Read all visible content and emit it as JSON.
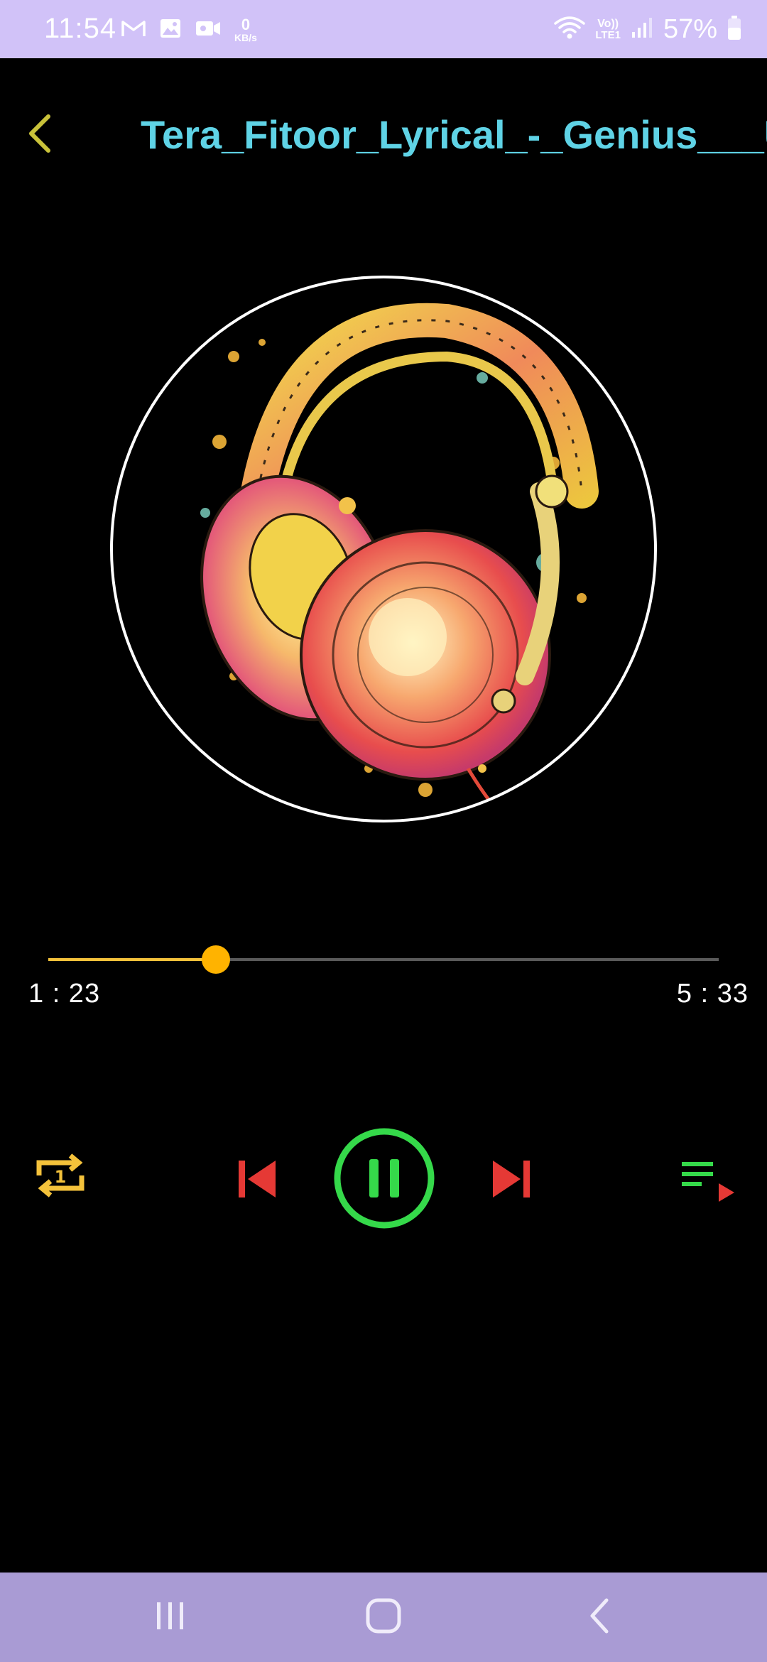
{
  "status_bar": {
    "time": "11:54",
    "network_speed_value": "0",
    "network_speed_unit": "KB/s",
    "volte_top": "Vo))",
    "volte_bottom": "LTE1",
    "battery": "57%",
    "icons_left": [
      "gmail-icon",
      "gallery-icon",
      "video-call-icon"
    ],
    "icons_right": [
      "wifi-icon",
      "signal-icon",
      "battery-icon"
    ]
  },
  "header": {
    "title": "Tera_Fitoor_Lyrical_-_Genius___Utkarsh_Sharma",
    "back_icon": "chevron-left-icon"
  },
  "player": {
    "elapsed": "1 : 23",
    "duration": "5 : 33",
    "progress": 0.25
  },
  "controls": {
    "repeat_icon": "repeat-one-icon",
    "previous_icon": "skip-previous-icon",
    "play_pause_icon": "pause-icon",
    "next_icon": "skip-next-icon",
    "queue_icon": "queue-music-icon"
  },
  "colors": {
    "accent_title": "#5fd3e6",
    "back_arrow": "#c9c23a",
    "seek_fill": "#f4c23b",
    "seek_thumb": "#ffb300",
    "repeat": "#f4c23b",
    "skip": "#e53935",
    "play_pause": "#35d94a",
    "queue_lines": "#35d94a",
    "queue_arrow": "#e53935",
    "status_bar_bg": "#d1c2f8",
    "nav_bar_bg": "#a99bd4"
  },
  "nav_bar": {
    "icons": [
      "recent-apps-icon",
      "home-icon",
      "back-icon"
    ]
  }
}
